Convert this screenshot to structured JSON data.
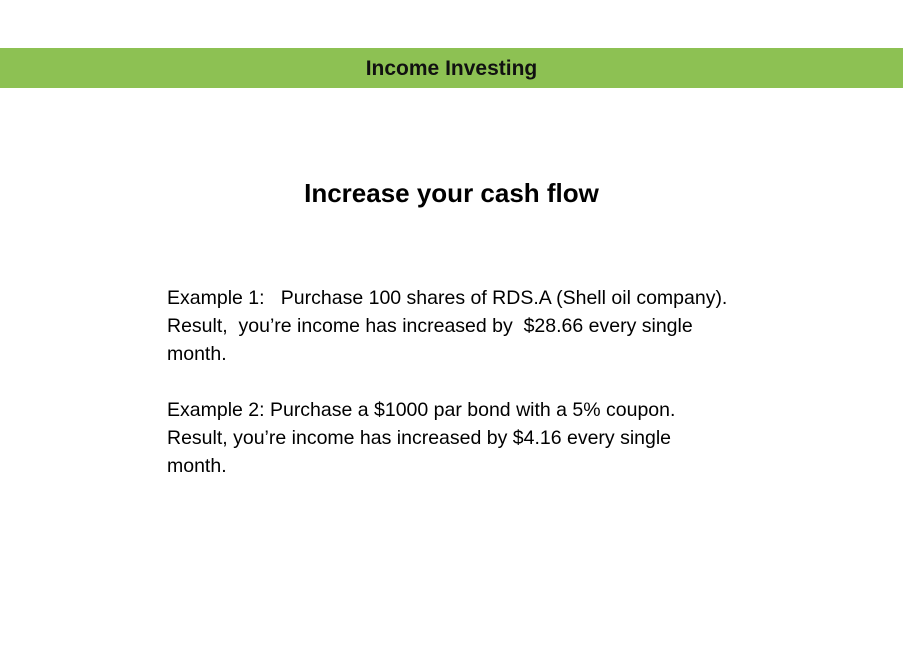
{
  "header": {
    "title": "Income Investing",
    "background_color": "#8dc153"
  },
  "slide": {
    "title": "Increase your cash flow",
    "examples": [
      {
        "lines": [
          "Example 1:   Purchase 100 shares of RDS.A (Shell oil company).",
          "Result,  you’re income has increased by  $28.66 every single",
          "month."
        ]
      },
      {
        "lines": [
          "Example 2: Purchase a $1000 par bond with a 5% coupon.",
          "Result, you’re income has increased by $4.16 every single",
          "month."
        ]
      }
    ]
  }
}
